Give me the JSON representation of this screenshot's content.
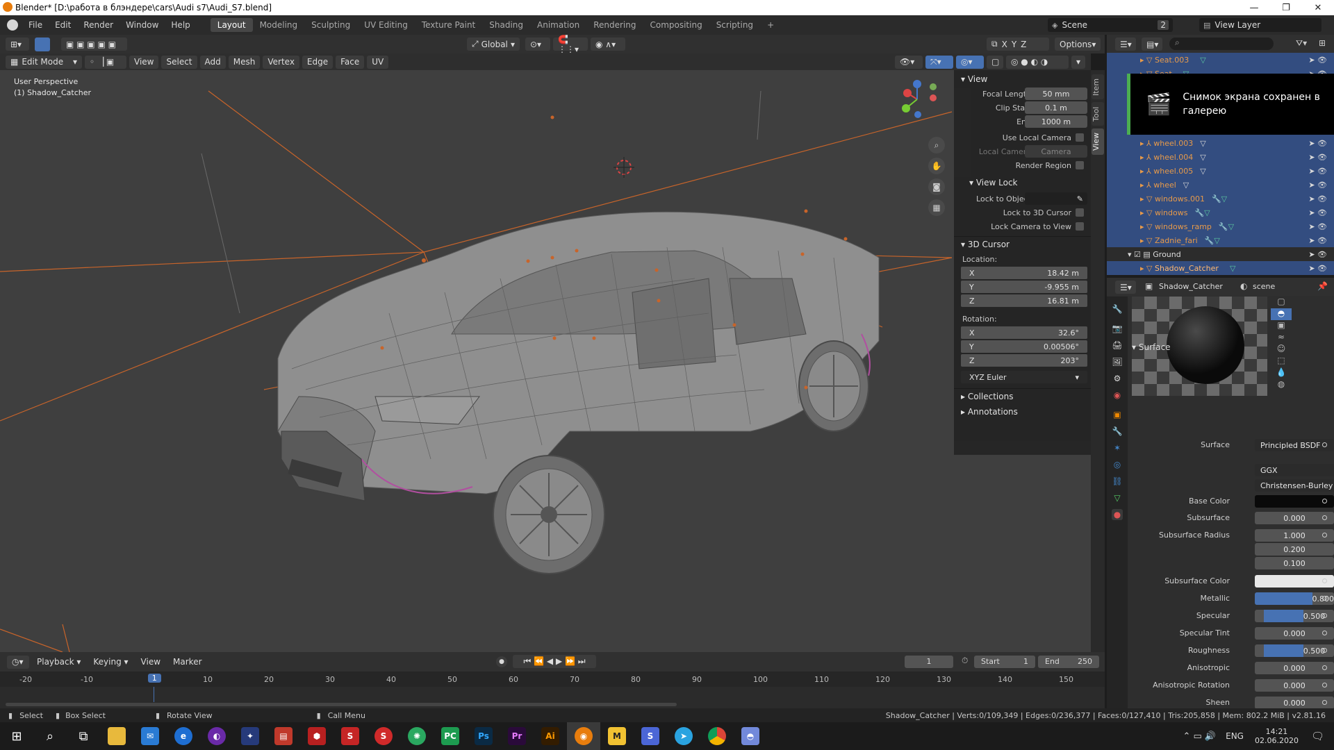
{
  "window": {
    "title": "Blender* [D:\\работа в блэндере\\cars\\Audi s7\\Audi_S7.blend]",
    "min": "—",
    "max": "❐",
    "close": "✕"
  },
  "menu": [
    "File",
    "Edit",
    "Render",
    "Window",
    "Help"
  ],
  "workspaces": [
    "Layout",
    "Modeling",
    "Sculpting",
    "UV Editing",
    "Texture Paint",
    "Shading",
    "Animation",
    "Rendering",
    "Compositing",
    "Scripting",
    "+"
  ],
  "scene": {
    "label": "Scene",
    "count": "2",
    "view_layer": "View Layer"
  },
  "viewport_header": {
    "mode": "Edit Mode",
    "menus": [
      "View",
      "Select",
      "Add",
      "Mesh",
      "Vertex",
      "Edge",
      "Face",
      "UV"
    ],
    "transform": "Global",
    "options": "Options",
    "axes": [
      "X",
      "Y",
      "Z"
    ]
  },
  "viewport": {
    "perspective": "User Perspective",
    "object": "(1) Shadow_Catcher"
  },
  "npanel": {
    "tabs": [
      "Item",
      "Tool",
      "View"
    ],
    "view_title": "View",
    "focal_label": "Focal Length",
    "focal": "50 mm",
    "clip_start_label": "Clip Start",
    "clip_start": "0.1 m",
    "clip_end_label": "End",
    "clip_end": "1000 m",
    "use_local_camera": "Use Local Camera",
    "local_camera_label": "Local Camera",
    "local_camera": "Camera",
    "render_region": "Render Region",
    "view_lock_title": "View Lock",
    "lock_to_object": "Lock to Object",
    "lock_3d_cursor": "Lock to 3D Cursor",
    "lock_camera": "Lock Camera to View",
    "cursor_title": "3D Cursor",
    "location_label": "Location:",
    "loc": [
      {
        "axis": "X",
        "value": "18.42 m"
      },
      {
        "axis": "Y",
        "value": "-9.955 m"
      },
      {
        "axis": "Z",
        "value": "16.81 m"
      }
    ],
    "rotation_label": "Rotation:",
    "rot": [
      {
        "axis": "X",
        "value": "32.6°"
      },
      {
        "axis": "Y",
        "value": "0.00506°"
      },
      {
        "axis": "Z",
        "value": "203°"
      }
    ],
    "rot_mode": "XYZ Euler",
    "collections": "Collections",
    "annotations": "Annotations"
  },
  "outliner": {
    "items": [
      {
        "name": "Seat.003"
      },
      {
        "name": "Seat"
      },
      {
        "name": "wheel.003"
      },
      {
        "name": "wheel.004"
      },
      {
        "name": "wheel.005"
      },
      {
        "name": "wheel"
      },
      {
        "name": "windows.001"
      },
      {
        "name": "windows"
      },
      {
        "name": "windows_ramp"
      },
      {
        "name": "Zadnie_fari"
      },
      {
        "name": "Ground"
      },
      {
        "name": "Shadow_Catcher"
      }
    ]
  },
  "toast": {
    "text": "Снимок экрана сохранен в галерею"
  },
  "properties": {
    "object": "Shadow_Catcher",
    "world": "scene",
    "surface_section": "Surface",
    "surface_label": "Surface",
    "surface": "Principled BSDF",
    "distribution": "GGX",
    "sss_method": "Christensen-Burley",
    "rows": [
      {
        "label": "Base Color",
        "value": "",
        "fill": 0,
        "kind": "color-dark"
      },
      {
        "label": "Subsurface",
        "value": "0.000",
        "fill": 0
      },
      {
        "label": "Subsurface Radius",
        "value": "1.000",
        "fill": 0
      },
      {
        "label": "",
        "value": "0.200",
        "fill": 0
      },
      {
        "label": "",
        "value": "0.100",
        "fill": 0
      },
      {
        "label": "Subsurface Color",
        "value": "",
        "fill": 0,
        "kind": "color-light"
      },
      {
        "label": "Metallic",
        "value": "0.800",
        "fill": 0.8
      },
      {
        "label": "Specular",
        "value": "0.500",
        "fill": 0.5
      },
      {
        "label": "Specular Tint",
        "value": "0.000",
        "fill": 0
      },
      {
        "label": "Roughness",
        "value": "0.500",
        "fill": 0.5
      },
      {
        "label": "Anisotropic",
        "value": "0.000",
        "fill": 0
      },
      {
        "label": "Anisotropic Rotation",
        "value": "0.000",
        "fill": 0
      },
      {
        "label": "Sheen",
        "value": "0.000",
        "fill": 0
      }
    ]
  },
  "timeline": {
    "menus": [
      "Playback",
      "Keying",
      "View",
      "Marker"
    ],
    "current": "1",
    "start_label": "Start",
    "start": "1",
    "end_label": "End",
    "end": "250",
    "ticks": [
      "-20",
      "-10",
      "1",
      "10",
      "20",
      "30",
      "40",
      "50",
      "60",
      "70",
      "80",
      "90",
      "100",
      "110",
      "120",
      "130",
      "140",
      "150"
    ]
  },
  "status": {
    "select": "Select",
    "box_select": "Box Select",
    "rotate": "Rotate View",
    "call_menu": "Call Menu",
    "stats": "Shadow_Catcher | Verts:0/109,349 | Edges:0/236,377 | Faces:0/127,410 | Tris:205,858 | Mem: 802.2 MiB | v2.81.16"
  },
  "taskbar": {
    "lang": "ENG",
    "time": "14:21",
    "date": "02.06.2020"
  },
  "colors": {
    "accent": "#4772b3",
    "selection": "#e79a4a",
    "toast_bar": "#4caf50"
  }
}
